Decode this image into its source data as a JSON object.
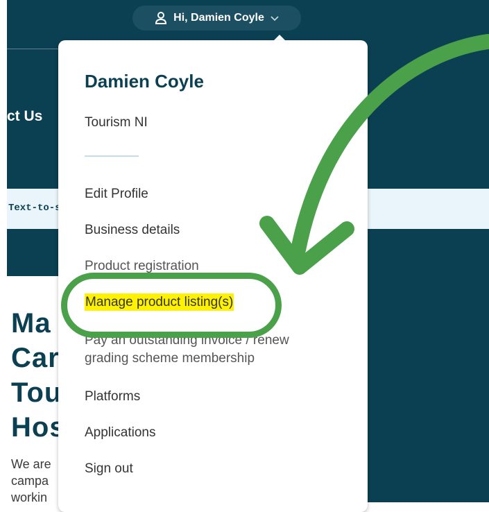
{
  "header": {
    "greeting": "Hi, Damien Coyle",
    "nav_partial": "ct Us"
  },
  "strip": {
    "text": "Text-to-s"
  },
  "hero": {
    "title_lines": [
      "Ma",
      "Car",
      "Tou",
      "Hos"
    ],
    "body_lines": [
      "We are",
      "campa",
      "workin"
    ]
  },
  "dropdown": {
    "name": "Damien Coyle",
    "organisation": "Tourism NI",
    "items": [
      "Edit Profile",
      "Business details",
      "Product registration",
      "Manage product listing(s)",
      "Pay an outstanding invoice / renew",
      "grading scheme membership",
      "Platforms",
      "Applications",
      "Sign out"
    ]
  },
  "colors": {
    "navy": "#0b3f52",
    "highlight": "#fff200",
    "annotation_green": "#4aa14a"
  },
  "icons": {
    "user": "user-icon",
    "chevron": "chevron-down-icon",
    "arrow": "curved-arrow-icon"
  }
}
